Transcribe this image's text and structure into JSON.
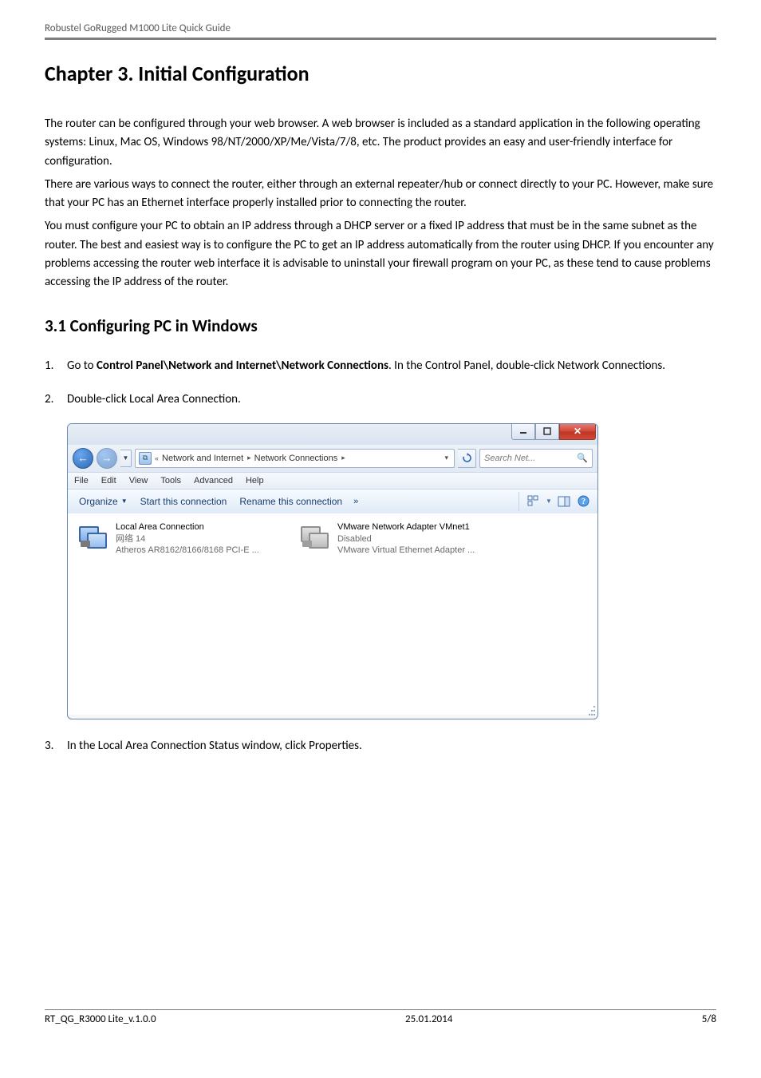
{
  "doc_header": "Robustel GoRugged M1000 Lite Quick Guide",
  "chapter_title": "Chapter 3.  Initial Configuration",
  "intro_para1": "The router can be configured through your web browser. A web browser is included as a standard application in the following operating systems: Linux, Mac OS, Windows 98/NT/2000/XP/Me/Vista/7/8, etc. The product provides an easy and user-friendly interface for configuration.",
  "intro_para2": "There are various ways to connect the router, either through an external repeater/hub or connect directly to your PC. However, make sure that your PC has an Ethernet interface properly installed prior to connecting the router.",
  "intro_para3": "You must configure your PC to obtain an IP address through a DHCP server or a fixed IP address that must be in the same subnet as the router. The best and easiest way is to configure the PC to get an IP address automatically from the router using DHCP. If you encounter any problems accessing the router web interface it is advisable to uninstall your firewall program on your PC, as these tend to cause problems accessing the IP address of the router.",
  "section_title": "3.1    Configuring PC in Windows",
  "step1_pre": "Go to ",
  "step1_bold": "Control Panel\\Network and Internet\\Network Connections",
  "step1_post": ". In the Control Panel, double-click Network Connections.",
  "step2": "Double-click Local Area Connection.",
  "step3": "In the Local Area Connection Status window, click Properties.",
  "win": {
    "breadcrumb": {
      "seg1": "Network and Internet",
      "seg2": "Network Connections"
    },
    "search_placeholder": "Search Net...",
    "menubar": [
      "File",
      "Edit",
      "View",
      "Tools",
      "Advanced",
      "Help"
    ],
    "cmdbar": {
      "organize": "Organize",
      "start": "Start this connection",
      "rename": "Rename this connection",
      "more": "»"
    },
    "connections": [
      {
        "title": "Local Area Connection",
        "sub1": "网络 14",
        "sub2": "Atheros AR8162/8166/8168 PCI-E ..."
      },
      {
        "title": "VMware Network Adapter VMnet1",
        "sub1": "Disabled",
        "sub2": "VMware Virtual Ethernet Adapter ..."
      }
    ]
  },
  "footer": {
    "left": "RT_QG_R3000 Lite_v.1.0.0",
    "center": "25.01.2014",
    "right": "5/8"
  }
}
